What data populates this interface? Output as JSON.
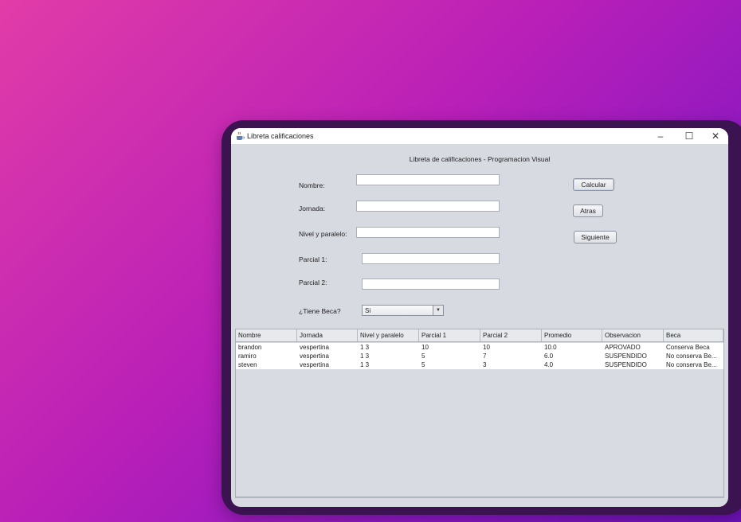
{
  "window": {
    "title": "Libreta calificaciones",
    "minimize_glyph": "–",
    "maximize_glyph": "☐",
    "close_glyph": "✕"
  },
  "form": {
    "header": "Libreta de calificaciones - Programacion Visual",
    "nombre_label": "Nombre:",
    "nombre_value": "",
    "jornada_label": "Jornada:",
    "jornada_value": "",
    "nivel_label": "Nivel y paralelo:",
    "nivel_value": "",
    "parcial1_label": "Parcial 1:",
    "parcial1_value": "",
    "parcial2_label": "Parcial 2:",
    "parcial2_value": "",
    "beca_label": "¿Tiene Beca?",
    "beca_selected": "Si"
  },
  "buttons": {
    "calcular": "Calcular",
    "atras": "Atras",
    "siguiente": "Siguiente"
  },
  "table": {
    "columns": [
      "Nombre",
      "Jornada",
      "Nivel y paralelo",
      "Parcial 1",
      "Parcial 2",
      "Promedio",
      "Observacion",
      "Beca"
    ],
    "rows": [
      [
        "brandon",
        "vespertina",
        "1 3",
        "10",
        "10",
        "10.0",
        "APROVADO",
        "Conserva Beca"
      ],
      [
        "ramiro",
        "vespertina",
        "1 3",
        "5",
        "7",
        "6.0",
        "SUSPENDIDO",
        "No conserva Be..."
      ],
      [
        "steven",
        "vespertina",
        "1 3",
        "5",
        "3",
        "4.0",
        "SUSPENDIDO",
        "No conserva Be..."
      ]
    ]
  },
  "icons": {
    "app": "java-cup-icon",
    "combo_arrow": "chevron-down-icon"
  },
  "colors": {
    "window_bg": "#d7dae1",
    "device_frame": "#3a1350",
    "background_start": "#e23ca8",
    "background_end": "#6b12b8"
  }
}
